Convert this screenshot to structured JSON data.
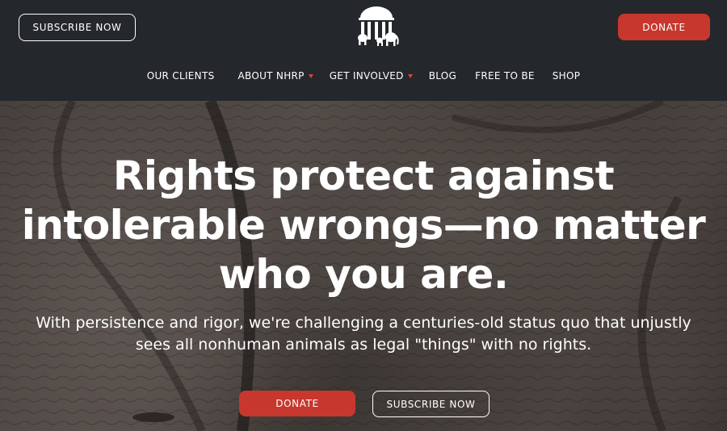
{
  "header": {
    "subscribe_label": "SUBSCRIBE NOW",
    "donate_label": "DONATE",
    "logo_icon": "courthouse-elephants-logo"
  },
  "nav": {
    "items": [
      {
        "label": "OUR CLIENTS",
        "has_dropdown": false
      },
      {
        "label": "ABOUT NHRP",
        "has_dropdown": true
      },
      {
        "label": "GET INVOLVED",
        "has_dropdown": true
      },
      {
        "label": "BLOG",
        "has_dropdown": false
      },
      {
        "label": "FREE TO BE",
        "has_dropdown": false
      },
      {
        "label": "SHOP",
        "has_dropdown": false
      }
    ]
  },
  "hero": {
    "headline_lines": [
      "Rights protect against",
      "intolerable wrongs—no matter",
      "who you are."
    ],
    "subhead_lines": [
      "With persistence and rigor, we're challenging a centuries-old status quo that unjustly",
      "sees all nonhuman animals as legal \"things\" with no rights."
    ],
    "donate_label": "DONATE",
    "subscribe_label": "SUBSCRIBE NOW"
  },
  "colors": {
    "header_bg": "#24272b",
    "accent_red": "#c8372d",
    "caret_red": "#d9443a",
    "text": "#ffffff"
  }
}
